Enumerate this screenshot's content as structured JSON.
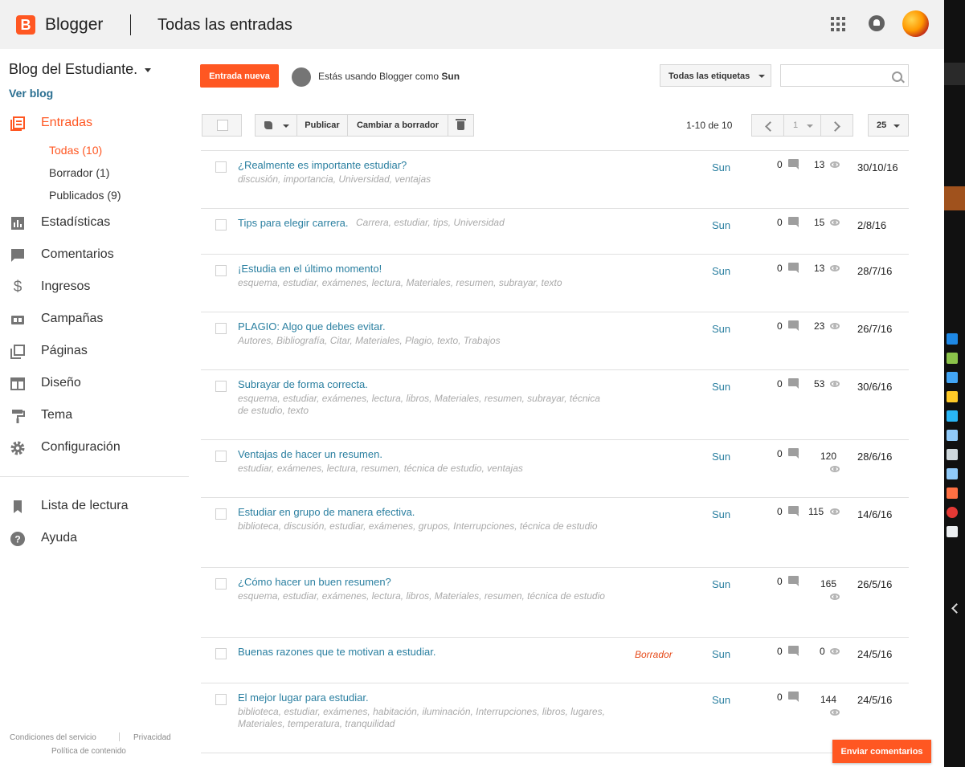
{
  "header": {
    "brand": "Blogger",
    "page_title": "Todas las entradas"
  },
  "sidebar": {
    "blog_name": "Blog del Estudiante.",
    "view_blog": "Ver blog",
    "posts_label": "Entradas",
    "sub_items": [
      {
        "label": "Todas (10)"
      },
      {
        "label": "Borrador (1)"
      },
      {
        "label": "Publicados (9)"
      }
    ],
    "items": [
      {
        "label": "Estadísticas"
      },
      {
        "label": "Comentarios"
      },
      {
        "label": "Ingresos"
      },
      {
        "label": "Campañas"
      },
      {
        "label": "Páginas"
      },
      {
        "label": "Diseño"
      },
      {
        "label": "Tema"
      },
      {
        "label": "Configuración"
      }
    ],
    "bottom_items": [
      {
        "label": "Lista de lectura"
      },
      {
        "label": "Ayuda"
      }
    ],
    "footer": {
      "terms": "Condiciones del servicio",
      "privacy": "Privacidad",
      "content_policy": "Política de contenido"
    }
  },
  "toolbar": {
    "new_post": "Entrada nueva",
    "using_prefix": "Estás usando Blogger como ",
    "using_user": "Sun",
    "labels_filter": "Todas las etiquetas",
    "search_placeholder": "",
    "publish": "Publicar",
    "revert_to_draft": "Cambiar a borrador",
    "range": "1-10 de 10",
    "page": "1",
    "per_page": "25"
  },
  "posts": [
    {
      "title": "¿Realmente es importante estudiar?",
      "labels": "discusión, importancia, Universidad, ventajas",
      "status": "",
      "author": "Sun",
      "comments": "0",
      "views": "13",
      "date": "30/10/16"
    },
    {
      "title": "Tips para elegir carrera.",
      "labels": "Carrera, estudiar, tips, Universidad",
      "status": "",
      "author": "Sun",
      "comments": "0",
      "views": "15",
      "date": "2/8/16"
    },
    {
      "title": "¡Estudia en el último momento!",
      "labels": "esquema, estudiar, exámenes, lectura, Materiales, resumen, subrayar, texto",
      "status": "",
      "author": "Sun",
      "comments": "0",
      "views": "13",
      "date": "28/7/16"
    },
    {
      "title": "PLAGIO: Algo que debes evitar.",
      "labels": "Autores, Bibliografía, Citar, Materiales, Plagio, texto, Trabajos",
      "status": "",
      "author": "Sun",
      "comments": "0",
      "views": "23",
      "date": "26/7/16"
    },
    {
      "title": "Subrayar de forma correcta.",
      "labels": "esquema, estudiar, exámenes, lectura, libros, Materiales, resumen, subrayar, técnica de estudio, texto",
      "status": "",
      "author": "Sun",
      "comments": "0",
      "views": "53",
      "date": "30/6/16"
    },
    {
      "title": "Ventajas de hacer un resumen.",
      "labels": "estudiar, exámenes, lectura, resumen, técnica de estudio, ventajas",
      "status": "",
      "author": "Sun",
      "comments": "0",
      "views": "120",
      "date": "28/6/16"
    },
    {
      "title": "Estudiar en grupo de manera efectiva.",
      "labels": "biblioteca, discusión, estudiar, exámenes, grupos, Interrupciones, técnica de estudio",
      "status": "",
      "author": "Sun",
      "comments": "0",
      "views": "115",
      "date": "14/6/16"
    },
    {
      "title": "¿Cómo hacer un buen resumen?",
      "labels": "esquema, estudiar, exámenes, lectura, libros, Materiales, resumen, técnica de estudio",
      "status": "",
      "author": "Sun",
      "comments": "0",
      "views": "165",
      "date": "26/5/16"
    },
    {
      "title": "Buenas razones que te motivan a estudiar.",
      "labels": "",
      "status": "Borrador",
      "author": "Sun",
      "comments": "0",
      "views": "0",
      "date": "24/5/16"
    },
    {
      "title": "El mejor lugar para estudiar.",
      "labels": "biblioteca, estudiar, exámenes, habitación, iluminación, Interrupciones, libros, lugares, Materiales, temperatura, tranquilidad",
      "status": "",
      "author": "Sun",
      "comments": "0",
      "views": "144",
      "date": "24/5/16"
    }
  ],
  "feedback": "Enviar comentarios",
  "colors": {
    "accent": "#ff5722",
    "link": "#2a7fa0",
    "label": "#aaaaaa"
  }
}
